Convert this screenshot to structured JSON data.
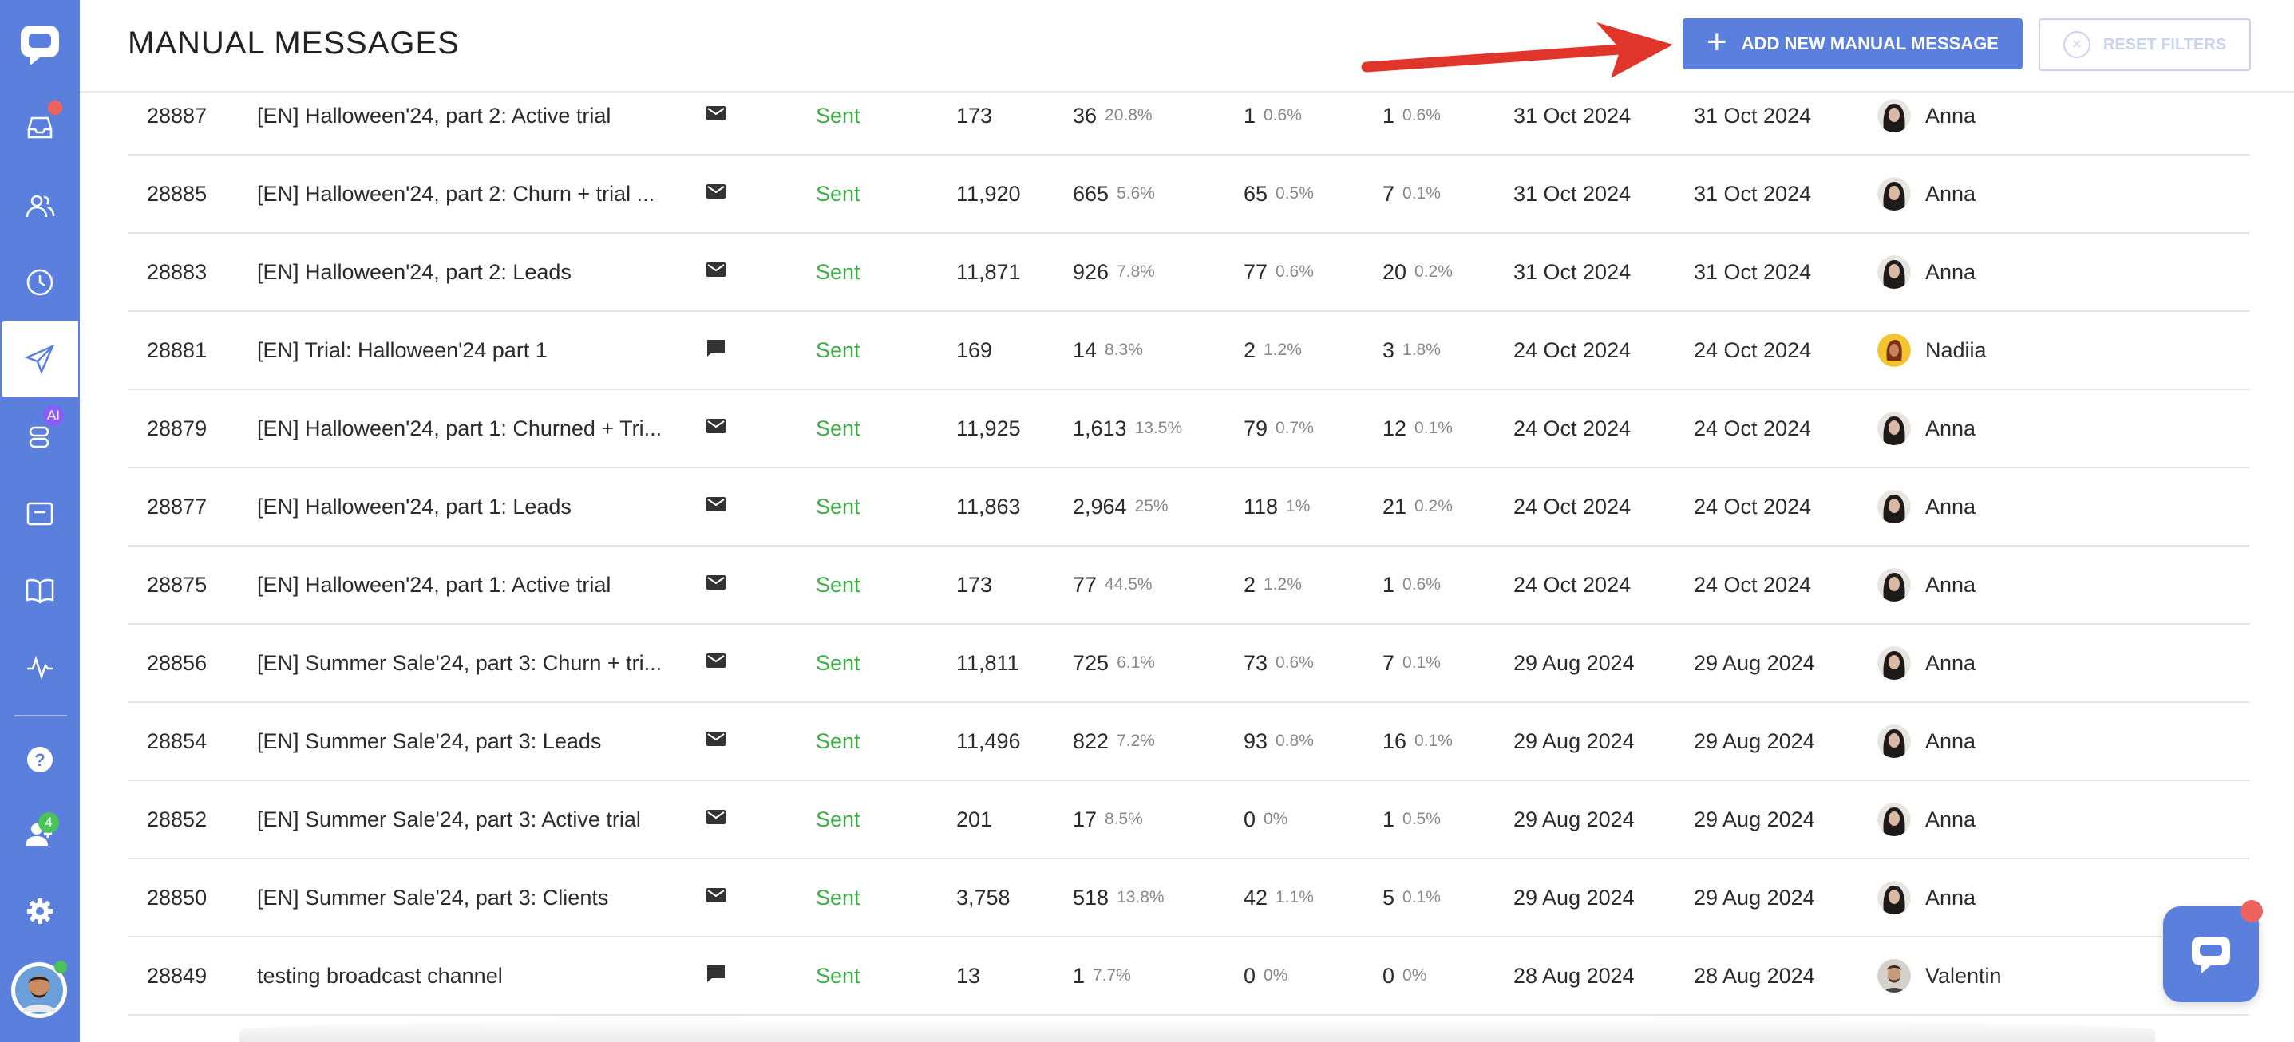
{
  "header": {
    "title": "MANUAL MESSAGES",
    "add_button_label": "ADD NEW MANUAL MESSAGE",
    "reset_button_label": "RESET FILTERS"
  },
  "sidebar": {
    "items": [
      {
        "icon": "inbox-icon",
        "has_dot": true
      },
      {
        "icon": "users-icon"
      },
      {
        "icon": "clock-icon"
      },
      {
        "icon": "paper-plane-icon",
        "active": true
      },
      {
        "icon": "ai-bot-icon",
        "badge": "AI"
      },
      {
        "icon": "card-icon"
      },
      {
        "icon": "book-icon"
      },
      {
        "icon": "activity-icon"
      },
      {
        "icon": "help-icon"
      },
      {
        "icon": "team-icon",
        "badge": "4"
      },
      {
        "icon": "gear-icon"
      }
    ]
  },
  "rows": [
    {
      "id": "28887",
      "name": "[EN] Halloween'24, part 2: Active trial",
      "channel": "email",
      "status": "Sent",
      "sent": "173",
      "opened": "36",
      "opened_pct": "20.8%",
      "clicked": "1",
      "clicked_pct": "0.6%",
      "replied": "1",
      "replied_pct": "0.6%",
      "created": "31 Oct 2024",
      "sent_date": "31 Oct 2024",
      "author": "Anna",
      "avatar": "dark"
    },
    {
      "id": "28885",
      "name": "[EN] Halloween'24, part 2: Churn + trial ...",
      "channel": "email",
      "status": "Sent",
      "sent": "11,920",
      "opened": "665",
      "opened_pct": "5.6%",
      "clicked": "65",
      "clicked_pct": "0.5%",
      "replied": "7",
      "replied_pct": "0.1%",
      "created": "31 Oct 2024",
      "sent_date": "31 Oct 2024",
      "author": "Anna",
      "avatar": "dark"
    },
    {
      "id": "28883",
      "name": "[EN] Halloween'24, part 2: Leads",
      "channel": "email",
      "status": "Sent",
      "sent": "11,871",
      "opened": "926",
      "opened_pct": "7.8%",
      "clicked": "77",
      "clicked_pct": "0.6%",
      "replied": "20",
      "replied_pct": "0.2%",
      "created": "31 Oct 2024",
      "sent_date": "31 Oct 2024",
      "author": "Anna",
      "avatar": "dark"
    },
    {
      "id": "28881",
      "name": "[EN] Trial: Halloween'24 part 1",
      "channel": "chat",
      "status": "Sent",
      "sent": "169",
      "opened": "14",
      "opened_pct": "8.3%",
      "clicked": "2",
      "clicked_pct": "1.2%",
      "replied": "3",
      "replied_pct": "1.8%",
      "created": "24 Oct 2024",
      "sent_date": "24 Oct 2024",
      "author": "Nadiia",
      "avatar": "yellow"
    },
    {
      "id": "28879",
      "name": "[EN] Halloween'24, part 1: Churned + Tri...",
      "channel": "email",
      "status": "Sent",
      "sent": "11,925",
      "opened": "1,613",
      "opened_pct": "13.5%",
      "clicked": "79",
      "clicked_pct": "0.7%",
      "replied": "12",
      "replied_pct": "0.1%",
      "created": "24 Oct 2024",
      "sent_date": "24 Oct 2024",
      "author": "Anna",
      "avatar": "dark"
    },
    {
      "id": "28877",
      "name": "[EN] Halloween'24, part 1: Leads",
      "channel": "email",
      "status": "Sent",
      "sent": "11,863",
      "opened": "2,964",
      "opened_pct": "25%",
      "clicked": "118",
      "clicked_pct": "1%",
      "replied": "21",
      "replied_pct": "0.2%",
      "created": "24 Oct 2024",
      "sent_date": "24 Oct 2024",
      "author": "Anna",
      "avatar": "dark"
    },
    {
      "id": "28875",
      "name": "[EN] Halloween'24, part 1: Active trial",
      "channel": "email",
      "status": "Sent",
      "sent": "173",
      "opened": "77",
      "opened_pct": "44.5%",
      "clicked": "2",
      "clicked_pct": "1.2%",
      "replied": "1",
      "replied_pct": "0.6%",
      "created": "24 Oct 2024",
      "sent_date": "24 Oct 2024",
      "author": "Anna",
      "avatar": "dark"
    },
    {
      "id": "28856",
      "name": "[EN] Summer Sale'24, part 3: Churn + tri...",
      "channel": "email",
      "status": "Sent",
      "sent": "11,811",
      "opened": "725",
      "opened_pct": "6.1%",
      "clicked": "73",
      "clicked_pct": "0.6%",
      "replied": "7",
      "replied_pct": "0.1%",
      "created": "29 Aug 2024",
      "sent_date": "29 Aug 2024",
      "author": "Anna",
      "avatar": "dark"
    },
    {
      "id": "28854",
      "name": "[EN] Summer Sale'24, part 3: Leads",
      "channel": "email",
      "status": "Sent",
      "sent": "11,496",
      "opened": "822",
      "opened_pct": "7.2%",
      "clicked": "93",
      "clicked_pct": "0.8%",
      "replied": "16",
      "replied_pct": "0.1%",
      "created": "29 Aug 2024",
      "sent_date": "29 Aug 2024",
      "author": "Anna",
      "avatar": "dark"
    },
    {
      "id": "28852",
      "name": "[EN] Summer Sale'24, part 3: Active trial",
      "channel": "email",
      "status": "Sent",
      "sent": "201",
      "opened": "17",
      "opened_pct": "8.5%",
      "clicked": "0",
      "clicked_pct": "0%",
      "replied": "1",
      "replied_pct": "0.5%",
      "created": "29 Aug 2024",
      "sent_date": "29 Aug 2024",
      "author": "Anna",
      "avatar": "dark"
    },
    {
      "id": "28850",
      "name": "[EN] Summer Sale'24, part 3: Clients",
      "channel": "email",
      "status": "Sent",
      "sent": "3,758",
      "opened": "518",
      "opened_pct": "13.8%",
      "clicked": "42",
      "clicked_pct": "1.1%",
      "replied": "5",
      "replied_pct": "0.1%",
      "created": "29 Aug 2024",
      "sent_date": "29 Aug 2024",
      "author": "Anna",
      "avatar": "dark"
    },
    {
      "id": "28849",
      "name": "testing broadcast channel",
      "channel": "chat",
      "status": "Sent",
      "sent": "13",
      "opened": "1",
      "opened_pct": "7.7%",
      "clicked": "0",
      "clicked_pct": "0%",
      "replied": "0",
      "replied_pct": "0%",
      "created": "28 Aug 2024",
      "sent_date": "28 Aug 2024",
      "author": "Valentin",
      "avatar": "beard"
    }
  ],
  "colors": {
    "brand": "#5b7fdc",
    "status_sent": "#3fae49",
    "notification": "#f0625e",
    "annotation_arrow": "#e0352b"
  }
}
